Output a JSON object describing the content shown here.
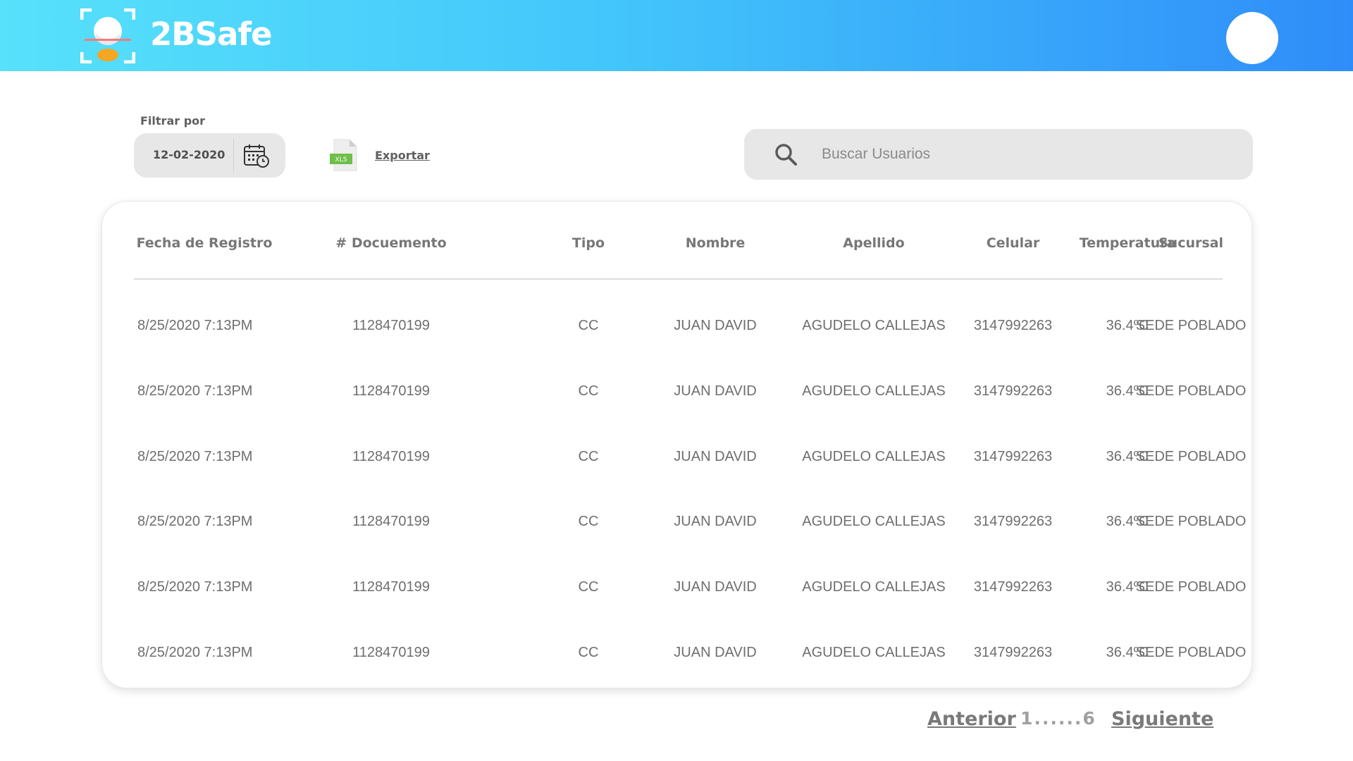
{
  "app": {
    "brand": "2BSafe"
  },
  "toolbar": {
    "filter_label": "Filtrar por",
    "date_value": "12-02-2020",
    "export_label": "Exportar",
    "export_badge": "XLS",
    "search_placeholder": "Buscar Usuarios",
    "search_value": ""
  },
  "table": {
    "columns": [
      "Fecha de Registro",
      "# Docuemento",
      "Tipo",
      "Nombre",
      "Apellido",
      "Celular",
      "Temperatura",
      "Sucursal"
    ],
    "rows": [
      [
        "8/25/2020 7:13PM",
        "1128470199",
        "CC",
        "JUAN DAVID",
        "AGUDELO CALLEJAS",
        "3147992263",
        "36.4ºC",
        "SEDE POBLADO"
      ],
      [
        "8/25/2020 7:13PM",
        "1128470199",
        "CC",
        "JUAN DAVID",
        "AGUDELO CALLEJAS",
        "3147992263",
        "36.4ºC",
        "SEDE POBLADO"
      ],
      [
        "8/25/2020 7:13PM",
        "1128470199",
        "CC",
        "JUAN DAVID",
        "AGUDELO CALLEJAS",
        "3147992263",
        "36.4ºC",
        "SEDE POBLADO"
      ],
      [
        "8/25/2020 7:13PM",
        "1128470199",
        "CC",
        "JUAN DAVID",
        "AGUDELO CALLEJAS",
        "3147992263",
        "36.4ºC",
        "SEDE POBLADO"
      ],
      [
        "8/25/2020 7:13PM",
        "1128470199",
        "CC",
        "JUAN DAVID",
        "AGUDELO CALLEJAS",
        "3147992263",
        "36.4ºC",
        "SEDE POBLADO"
      ],
      [
        "8/25/2020 7:13PM",
        "1128470199",
        "CC",
        "JUAN DAVID",
        "AGUDELO CALLEJAS",
        "3147992263",
        "36.4ºC",
        "SEDE POBLADO"
      ]
    ]
  },
  "pagination": {
    "prev_label": "Anterior",
    "range_label": "1......6",
    "next_label": "Siguiente"
  },
  "colors": {
    "header_gradient_start": "#57e1fb",
    "header_gradient_end": "#2f8df9",
    "xls_green": "#6fbf4a"
  },
  "icons": [
    "face-scan-logo-icon",
    "calendar-clock-icon",
    "xls-file-icon",
    "search-icon"
  ]
}
